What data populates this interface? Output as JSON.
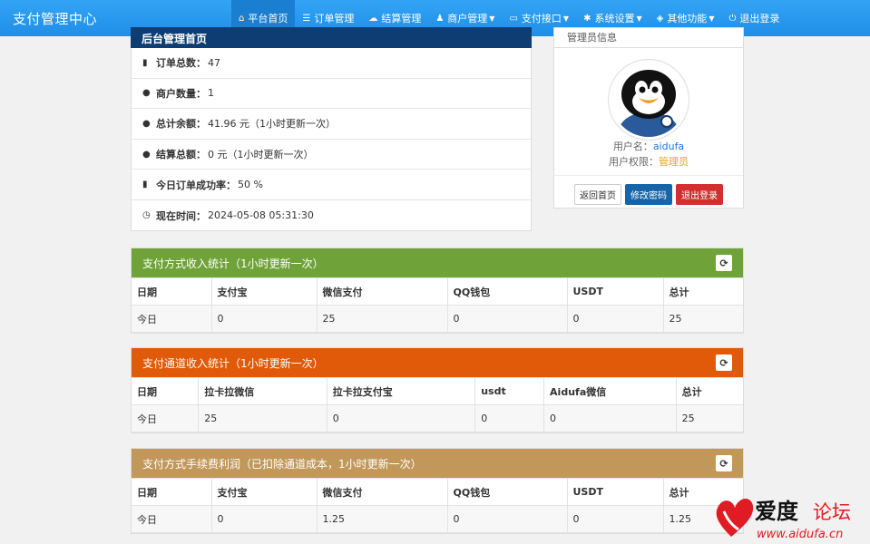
{
  "brand": "支付管理中心",
  "nav": [
    {
      "label": "平台首页",
      "icon": "home-icon",
      "glyph": "⌂",
      "caret": false,
      "active": true
    },
    {
      "label": "订单管理",
      "icon": "list-icon",
      "glyph": "☰",
      "caret": false,
      "active": false
    },
    {
      "label": "结算管理",
      "icon": "cloud-icon",
      "glyph": "☁",
      "caret": false,
      "active": false
    },
    {
      "label": "商户管理",
      "icon": "user-icon",
      "glyph": "♟",
      "caret": true,
      "active": false
    },
    {
      "label": "支付接口",
      "icon": "card-icon",
      "glyph": "▭",
      "caret": true,
      "active": false
    },
    {
      "label": "系统设置",
      "icon": "gear-icon",
      "glyph": "✱",
      "caret": true,
      "active": false
    },
    {
      "label": "其他功能",
      "icon": "cube-icon",
      "glyph": "◈",
      "caret": true,
      "active": false
    },
    {
      "label": "退出登录",
      "icon": "power-icon",
      "glyph": "⏻",
      "caret": false,
      "active": false
    }
  ],
  "info": {
    "title": "后台管理首页",
    "rows": [
      {
        "icon": "bar-chart-icon",
        "glyph": "▮",
        "label": "订单总数：",
        "value": "47"
      },
      {
        "icon": "drop-icon",
        "glyph": "●",
        "label": "商户数量：",
        "value": "1"
      },
      {
        "icon": "drop-icon",
        "glyph": "●",
        "label": "总计余额：",
        "value": "41.96 元（1小时更新一次）"
      },
      {
        "icon": "drop-icon",
        "glyph": "●",
        "label": "结算总额：",
        "value": "0 元（1小时更新一次）"
      },
      {
        "icon": "bar-chart-icon",
        "glyph": "▮",
        "label": "今日订单成功率：",
        "value": "50 %"
      },
      {
        "icon": "clock-icon",
        "glyph": "◷",
        "label": "现在时间：",
        "value": " 2024-05-08 05:31:30"
      }
    ]
  },
  "user": {
    "title": "管理员信息",
    "name_label": "用户名：",
    "name": "aidufa",
    "role_label": "用户权限：",
    "role": "管理员",
    "btn_home": "返回首页",
    "btn_password": "修改密码",
    "btn_logout": "退出登录"
  },
  "panels": [
    {
      "title": "支付方式收入统计（1小时更新一次）",
      "color": "#6fa33a",
      "headers": [
        "日期",
        "支付宝",
        "微信支付",
        "QQ钱包",
        "USDT",
        "总计"
      ],
      "widths": [
        88,
        116,
        144,
        132,
        106,
        88
      ],
      "row": [
        "今日",
        "0",
        "25",
        "0",
        "0",
        "25"
      ]
    },
    {
      "title": "支付通道收入统计（1小时更新一次）",
      "color": "#e05a0a",
      "headers": [
        "日期",
        "拉卡拉微信",
        "拉卡拉支付宝",
        "usdt",
        "Aidufa微信",
        "总计"
      ],
      "widths": [
        74,
        142,
        164,
        76,
        146,
        74
      ],
      "row": [
        "今日",
        "25",
        "0",
        "0",
        "0",
        "25"
      ]
    },
    {
      "title": "支付方式手续费利润（已扣除通道成本，1小时更新一次）",
      "color": "#c2975a",
      "headers": [
        "日期",
        "支付宝",
        "微信支付",
        "QQ钱包",
        "USDT",
        "总计"
      ],
      "widths": [
        88,
        116,
        144,
        132,
        106,
        88
      ],
      "row": [
        "今日",
        "0",
        "1.25",
        "0",
        "0",
        "1.25"
      ]
    }
  ],
  "watermark": {
    "title": "爱度论坛",
    "url": "www.aidufa.cn"
  }
}
